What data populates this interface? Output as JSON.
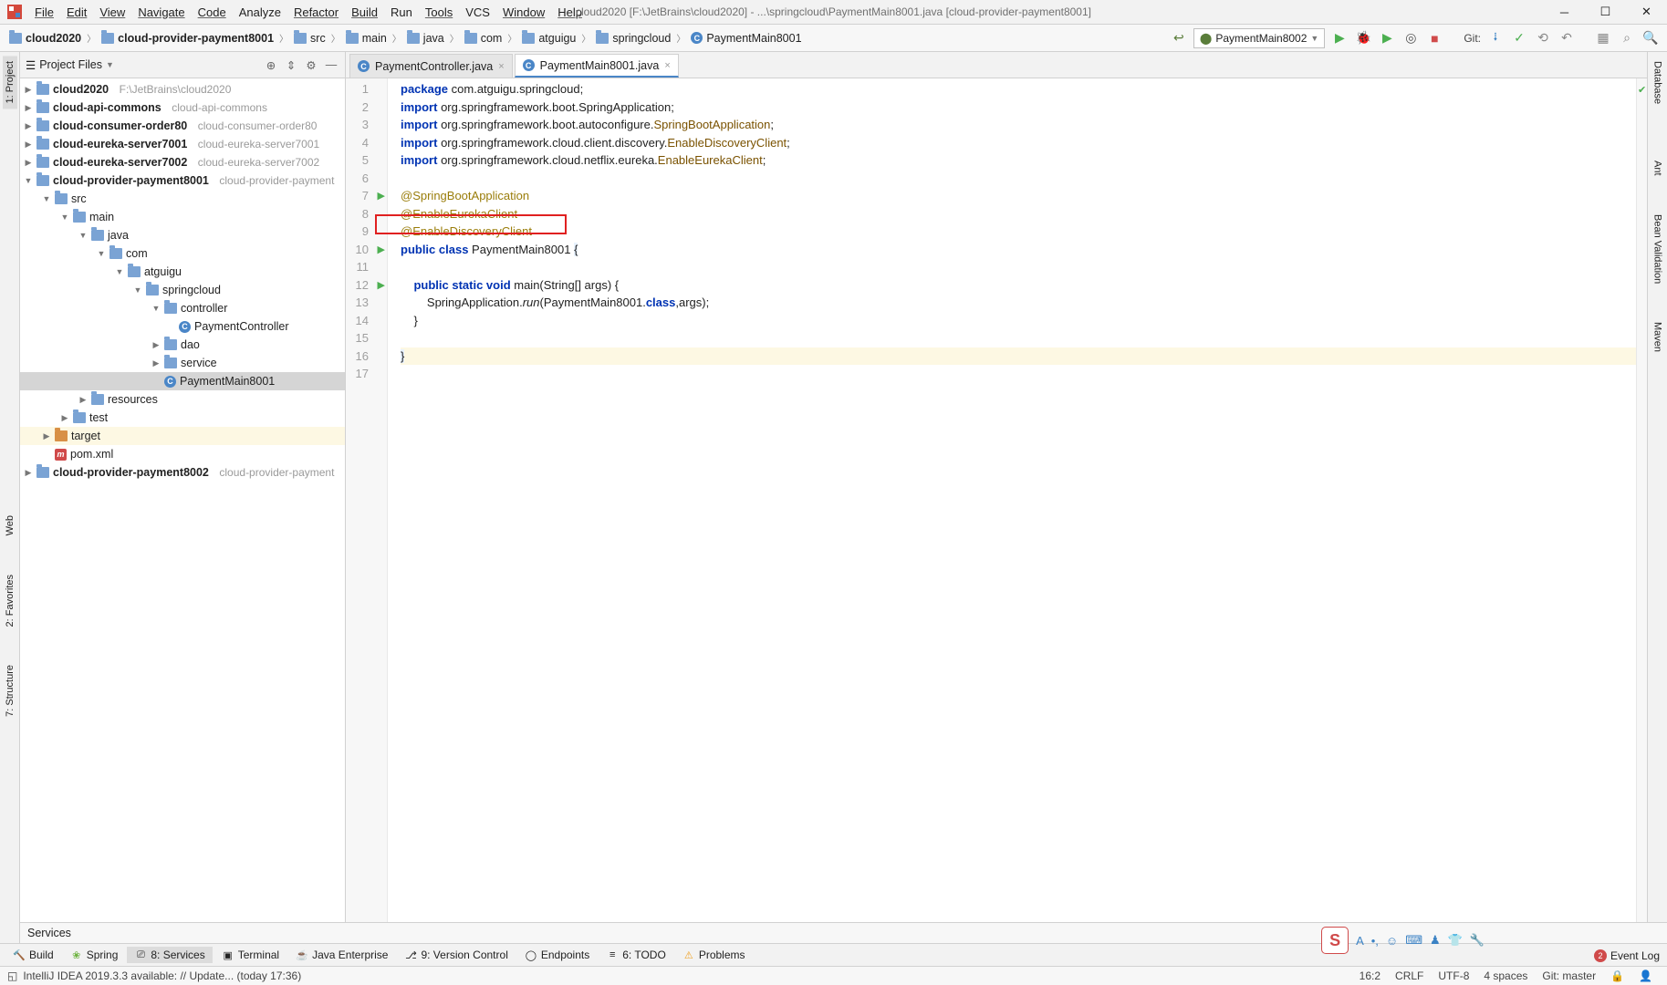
{
  "window": {
    "title": "cloud2020 [F:\\JetBrains\\cloud2020] - ...\\springcloud\\PaymentMain8001.java [cloud-provider-payment8001]"
  },
  "menus": [
    "File",
    "Edit",
    "View",
    "Navigate",
    "Code",
    "Analyze",
    "Refactor",
    "Build",
    "Run",
    "Tools",
    "VCS",
    "Window",
    "Help"
  ],
  "breadcrumb": [
    "cloud2020",
    "cloud-provider-payment8001",
    "src",
    "main",
    "java",
    "com",
    "atguigu",
    "springcloud",
    "PaymentMain8001"
  ],
  "run_config": "PaymentMain8002",
  "git_label": "Git:",
  "project_header": "Project Files",
  "tree": {
    "n0": {
      "label": "cloud2020",
      "hint": "F:\\JetBrains\\cloud2020"
    },
    "n1": {
      "label": "cloud-api-commons",
      "hint": "cloud-api-commons"
    },
    "n2": {
      "label": "cloud-consumer-order80",
      "hint": "cloud-consumer-order80"
    },
    "n3": {
      "label": "cloud-eureka-server7001",
      "hint": "cloud-eureka-server7001"
    },
    "n4": {
      "label": "cloud-eureka-server7002",
      "hint": "cloud-eureka-server7002"
    },
    "n5": {
      "label": "cloud-provider-payment8001",
      "hint": "cloud-provider-payment"
    },
    "n5a": {
      "label": "src"
    },
    "n5b": {
      "label": "main"
    },
    "n5c": {
      "label": "java"
    },
    "n5d": {
      "label": "com"
    },
    "n5e": {
      "label": "atguigu"
    },
    "n5f": {
      "label": "springcloud"
    },
    "n5g": {
      "label": "controller"
    },
    "n5h": {
      "label": "PaymentController"
    },
    "n5i": {
      "label": "dao"
    },
    "n5j": {
      "label": "service"
    },
    "n5k": {
      "label": "PaymentMain8001"
    },
    "n5l": {
      "label": "resources"
    },
    "n5m": {
      "label": "test"
    },
    "n5n": {
      "label": "target"
    },
    "n5o": {
      "label": "pom.xml"
    },
    "n6": {
      "label": "cloud-provider-payment8002",
      "hint": "cloud-provider-payment"
    }
  },
  "tabs": [
    {
      "label": "PaymentController.java"
    },
    {
      "label": "PaymentMain8001.java"
    }
  ],
  "code": {
    "l1_a": "package ",
    "l1_b": "com.atguigu.springcloud;",
    "l2_a": "import ",
    "l2_b": "org.springframework.boot.SpringApplication;",
    "l3_a": "import ",
    "l3_b": "org.springframework.boot.autoconfigure.",
    "l3_c": "SpringBootApplication",
    "l3_d": ";",
    "l4_a": "import ",
    "l4_b": "org.springframework.cloud.client.discovery.",
    "l4_c": "EnableDiscoveryClient",
    "l4_d": ";",
    "l5_a": "import ",
    "l5_b": "org.springframework.cloud.netflix.eureka.",
    "l5_c": "EnableEurekaClient",
    "l5_d": ";",
    "l7": "@SpringBootApplication",
    "l8": "@EnableEurekaClient",
    "l9": "@EnableDiscoveryClient",
    "l10_a": "public class ",
    "l10_b": "PaymentMain8001 ",
    "l10_c": "{",
    "l12_a": "    public static void ",
    "l12_b": "main(String[] args) {",
    "l13_a": "        SpringApplication.",
    "l13_b": "run",
    "l13_c": "(PaymentMain8001.",
    "l13_d": "class",
    "l13_e": ",args);",
    "l14": "    }",
    "l16": "}"
  },
  "line_numbers": [
    "1",
    "2",
    "3",
    "4",
    "5",
    "6",
    "7",
    "8",
    "9",
    "10",
    "11",
    "12",
    "13",
    "14",
    "15",
    "16",
    "17"
  ],
  "editor_breadcrumb": "PaymentMain8001",
  "left_rail": {
    "project": "1: Project",
    "web": "Web",
    "favorites": "2: Favorites",
    "structure": "7: Structure"
  },
  "right_rail": {
    "database": "Database",
    "ant": "Ant",
    "bean": "Bean Validation",
    "maven": "Maven"
  },
  "services_label": "Services",
  "tool_tabs": {
    "build": "Build",
    "spring": "Spring",
    "services": "8: Services",
    "terminal": "Terminal",
    "jee": "Java Enterprise",
    "vcs": "9: Version Control",
    "endpoints": "Endpoints",
    "todo": "6: TODO",
    "problems": "Problems"
  },
  "event_log": {
    "label": "Event Log",
    "count": "2"
  },
  "status": {
    "msg": "IntelliJ IDEA 2019.3.3 available: // Update... (today 17:36)",
    "pos": "16:2",
    "eol": "CRLF",
    "enc": "UTF-8",
    "indent": "4 spaces",
    "git": "Git: master"
  }
}
